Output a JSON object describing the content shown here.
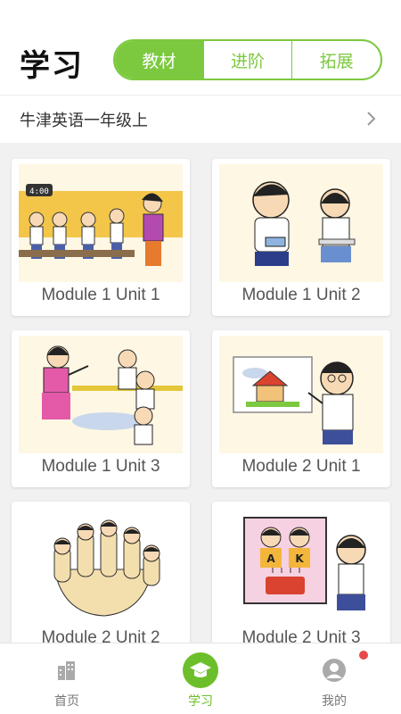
{
  "header": {
    "title": "学习",
    "tabs": [
      {
        "label": "教材",
        "active": true
      },
      {
        "label": "进阶",
        "active": false
      },
      {
        "label": "拓展",
        "active": false
      }
    ]
  },
  "book": {
    "label": "牛津英语一年级上"
  },
  "units": [
    {
      "title": "Module 1 Unit 1"
    },
    {
      "title": "Module 1 Unit 2"
    },
    {
      "title": "Module 1 Unit 3"
    },
    {
      "title": "Module 2 Unit 1"
    },
    {
      "title": "Module 2 Unit 2"
    },
    {
      "title": "Module 2 Unit 3"
    }
  ],
  "classroom_clock": "4:00",
  "cake_letters": [
    "A",
    "K"
  ],
  "tabbar": {
    "items": [
      {
        "label": "首页",
        "icon": "buildings-icon"
      },
      {
        "label": "学习",
        "icon": "graduation-cap-icon"
      },
      {
        "label": "我的",
        "icon": "user-icon"
      }
    ],
    "active": "学习"
  },
  "colors": {
    "accent": "#7cc93f",
    "badge": "#e84a4a"
  }
}
